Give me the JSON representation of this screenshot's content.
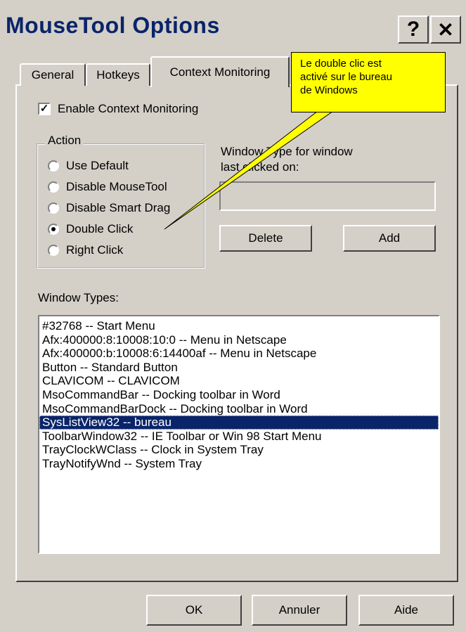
{
  "window": {
    "title": "MouseTool Options",
    "help_button": "?",
    "close_button": "✕"
  },
  "tabs": [
    {
      "label": "General",
      "active": false
    },
    {
      "label": "Hotkeys",
      "active": false
    },
    {
      "label": "Context Monitoring",
      "active": true
    }
  ],
  "enable_context": {
    "label": "Enable Context Monitoring",
    "checked": true,
    "mark": "✓"
  },
  "action_group": {
    "title": "Action",
    "options": [
      {
        "label": "Use Default",
        "checked": false
      },
      {
        "label": "Disable MouseTool",
        "checked": false
      },
      {
        "label": "Disable Smart Drag",
        "checked": false
      },
      {
        "label": "Double Click",
        "checked": true
      },
      {
        "label": "Right Click",
        "checked": false
      }
    ]
  },
  "window_type_label": {
    "line1": "Window Type for window",
    "line2": "last clicked on:"
  },
  "window_type_field": {
    "value": ""
  },
  "buttons": {
    "delete": "Delete",
    "add": "Add",
    "ok": "OK",
    "cancel": "Annuler",
    "help": "Aide"
  },
  "window_types": {
    "label": "Window Types:",
    "items": [
      "#32768 -- Start Menu",
      "Afx:400000:8:10008:10:0 -- Menu in Netscape",
      "Afx:400000:b:10008:6:14400af -- Menu in Netscape",
      "Button -- Standard Button",
      "CLAVICOM -- CLAVICOM",
      "MsoCommandBar -- Docking toolbar in Word",
      "MsoCommandBarDock -- Docking toolbar in Word",
      "SysListView32 -- bureau",
      "ToolbarWindow32 -- IE Toolbar or Win 98 Start Menu",
      "TrayClockWClass -- Clock in System Tray",
      "TrayNotifyWnd -- System Tray"
    ],
    "selected_index": 7
  },
  "callout": {
    "lines": [
      "Le double clic est",
      "activé sur le bureau",
      "de Windows"
    ],
    "color": "#ffff00"
  }
}
